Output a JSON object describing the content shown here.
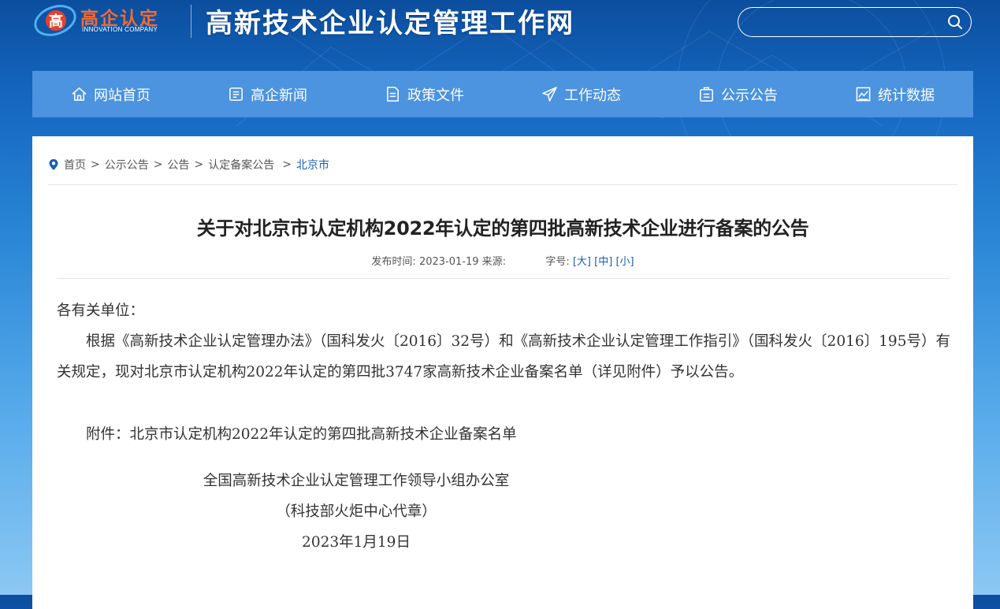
{
  "header": {
    "logo_cn": "高企认定",
    "logo_en": "INNOVATION COMPANY",
    "site_title": "高新技术企业认定管理工作网",
    "search_placeholder": ""
  },
  "nav": {
    "items": [
      {
        "label": "网站首页",
        "icon": "home-icon"
      },
      {
        "label": "高企新闻",
        "icon": "news-icon"
      },
      {
        "label": "政策文件",
        "icon": "document-icon"
      },
      {
        "label": "工作动态",
        "icon": "send-icon"
      },
      {
        "label": "公示公告",
        "icon": "announcement-icon"
      },
      {
        "label": "统计数据",
        "icon": "chart-icon"
      }
    ]
  },
  "breadcrumb": [
    "首页",
    "公示公告",
    "公告",
    "认定备案公告",
    "北京市"
  ],
  "article": {
    "title": "关于对北京市认定机构2022年认定的第四批高新技术企业进行备案的公告",
    "publish_label": "发布时间:",
    "publish_date": "2023-01-19",
    "source_label": "来源:",
    "source_value": "",
    "font_label": "字号:",
    "font_large": "[大]",
    "font_medium": "[中]",
    "font_small": "[小]",
    "salutation": "各有关单位：",
    "paragraph": "根据《高新技术企业认定管理办法》（国科发火〔2016〕32号）和《高新技术企业认定管理工作指引》（国科发火〔2016〕195号）有关规定，现对北京市认定机构2022年认定的第四批3747家高新技术企业备案名单（详见附件）予以公告。",
    "attachment": "附件：北京市认定机构2022年认定的第四批高新技术企业备案名单",
    "signer": "全国高新技术企业认定管理工作领导小组办公室",
    "signer_note": "（科技部火炬中心代章）",
    "sign_date": "2023年1月19日"
  },
  "colors": {
    "nav_bg": "#4c93e0",
    "accent_orange": "#f56a30",
    "link_blue": "#1a5fb4"
  }
}
